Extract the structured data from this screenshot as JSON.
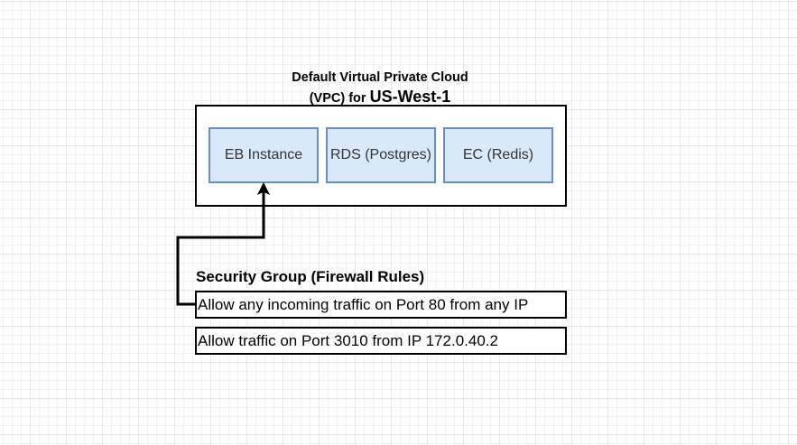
{
  "vpc": {
    "title_line1": "Default Virtual Private Cloud",
    "title_line2_prefix": "(VPC) for ",
    "title_line2_region": "US-West-1"
  },
  "services": [
    {
      "label": "EB Instance"
    },
    {
      "label": "RDS (Postgres)"
    },
    {
      "label": "EC (Redis)"
    }
  ],
  "security_group": {
    "title": "Security Group (Firewall Rules)",
    "rules": [
      {
        "text": "Allow any incoming traffic on Port 80 from any IP"
      },
      {
        "text": "Allow traffic on Port 3010 from IP 172.0.40.2"
      }
    ]
  },
  "colors": {
    "service_fill": "#dae8fc",
    "service_border": "#6c8ebf",
    "line": "#000000"
  }
}
